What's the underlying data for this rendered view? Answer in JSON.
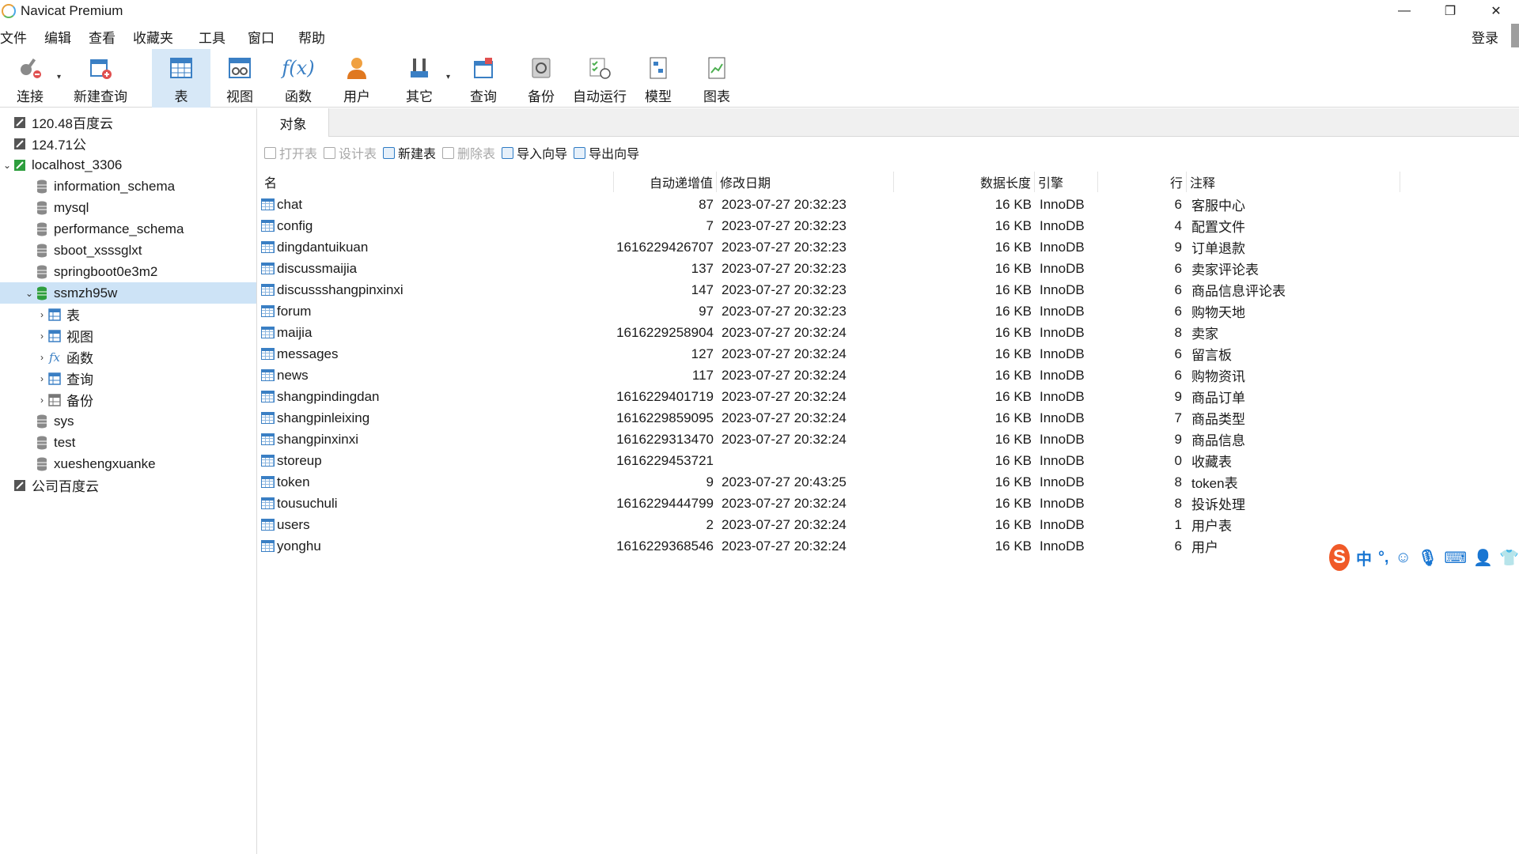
{
  "window": {
    "title": "Navicat Premium",
    "controls": [
      "—",
      "❐",
      "✕"
    ]
  },
  "menu": {
    "items": [
      "文件",
      "编辑",
      "查看",
      "收藏夹",
      "工具",
      "窗口",
      "帮助"
    ],
    "login": "登录"
  },
  "toolbar": {
    "items": [
      {
        "label": "连接",
        "icon": "connection-icon"
      },
      {
        "label": "新建查询",
        "icon": "new-query-icon"
      },
      {
        "label": "表",
        "icon": "table-icon",
        "active": true
      },
      {
        "label": "视图",
        "icon": "view-icon"
      },
      {
        "label": "函数",
        "icon": "function-icon",
        "glyph": "f(x)"
      },
      {
        "label": "用户",
        "icon": "user-icon"
      },
      {
        "label": "其它",
        "icon": "tools-icon"
      },
      {
        "label": "查询",
        "icon": "query-icon"
      },
      {
        "label": "备份",
        "icon": "backup-icon"
      },
      {
        "label": "自动运行",
        "icon": "schedule-icon"
      },
      {
        "label": "模型",
        "icon": "model-icon"
      },
      {
        "label": "图表",
        "icon": "chart-icon"
      }
    ]
  },
  "sidebar": {
    "items": [
      {
        "label": "120.48百度云",
        "level": 0,
        "icon": "connection-icon",
        "arrow": ""
      },
      {
        "label": "124.71公",
        "level": 0,
        "icon": "connection-icon",
        "arrow": ""
      },
      {
        "label": "localhost_3306",
        "level": 0,
        "icon": "connection-active-icon",
        "arrow": "⌄"
      },
      {
        "label": "information_schema",
        "level": 1,
        "icon": "database-icon",
        "arrow": ""
      },
      {
        "label": "mysql",
        "level": 1,
        "icon": "database-icon",
        "arrow": ""
      },
      {
        "label": "performance_schema",
        "level": 1,
        "icon": "database-icon",
        "arrow": ""
      },
      {
        "label": "sboot_xsssglxt",
        "level": 1,
        "icon": "database-icon",
        "arrow": ""
      },
      {
        "label": "springboot0e3m2",
        "level": 1,
        "icon": "database-icon",
        "arrow": ""
      },
      {
        "label": "ssmzh95w",
        "level": 1,
        "icon": "database-open-icon",
        "arrow": "⌄",
        "selected": true
      },
      {
        "label": "表",
        "level": 2,
        "icon": "table-icon",
        "arrow": "›"
      },
      {
        "label": "视图",
        "level": 2,
        "icon": "view-icon",
        "arrow": "›"
      },
      {
        "label": "函数",
        "level": 2,
        "icon": "function-icon",
        "arrow": "›"
      },
      {
        "label": "查询",
        "level": 2,
        "icon": "query-icon",
        "arrow": "›"
      },
      {
        "label": "备份",
        "level": 2,
        "icon": "backup-icon",
        "arrow": "›"
      },
      {
        "label": "sys",
        "level": 1,
        "icon": "database-icon",
        "arrow": ""
      },
      {
        "label": "test",
        "level": 1,
        "icon": "database-icon",
        "arrow": ""
      },
      {
        "label": "xueshengxuanke",
        "level": 1,
        "icon": "database-icon",
        "arrow": ""
      },
      {
        "label": "公司百度云",
        "level": 0,
        "icon": "connection-icon",
        "arrow": ""
      }
    ]
  },
  "tabs": {
    "objects": "对象"
  },
  "object_toolbar": {
    "items": [
      {
        "label": "打开表",
        "enabled": false
      },
      {
        "label": "设计表",
        "enabled": false
      },
      {
        "label": "新建表",
        "enabled": true
      },
      {
        "label": "删除表",
        "enabled": false
      },
      {
        "label": "导入向导",
        "enabled": true
      },
      {
        "label": "导出向导",
        "enabled": true
      }
    ]
  },
  "table": {
    "columns": [
      "名",
      "自动递增值",
      "修改日期",
      "数据长度",
      "引擎",
      "行",
      "注释"
    ],
    "rows": [
      {
        "name": "chat",
        "auto_inc": "87",
        "modified": "2023-07-27 20:32:23",
        "size": "16 KB",
        "engine": "InnoDB",
        "rows": "6",
        "comment": "客服中心"
      },
      {
        "name": "config",
        "auto_inc": "7",
        "modified": "2023-07-27 20:32:23",
        "size": "16 KB",
        "engine": "InnoDB",
        "rows": "4",
        "comment": "配置文件"
      },
      {
        "name": "dingdantuikuan",
        "auto_inc": "1616229426707",
        "modified": "2023-07-27 20:32:23",
        "size": "16 KB",
        "engine": "InnoDB",
        "rows": "9",
        "comment": "订单退款"
      },
      {
        "name": "discussmaijia",
        "auto_inc": "137",
        "modified": "2023-07-27 20:32:23",
        "size": "16 KB",
        "engine": "InnoDB",
        "rows": "6",
        "comment": "卖家评论表"
      },
      {
        "name": "discussshangpinxinxi",
        "auto_inc": "147",
        "modified": "2023-07-27 20:32:23",
        "size": "16 KB",
        "engine": "InnoDB",
        "rows": "6",
        "comment": "商品信息评论表"
      },
      {
        "name": "forum",
        "auto_inc": "97",
        "modified": "2023-07-27 20:32:23",
        "size": "16 KB",
        "engine": "InnoDB",
        "rows": "6",
        "comment": "购物天地"
      },
      {
        "name": "maijia",
        "auto_inc": "1616229258904",
        "modified": "2023-07-27 20:32:24",
        "size": "16 KB",
        "engine": "InnoDB",
        "rows": "8",
        "comment": "卖家"
      },
      {
        "name": "messages",
        "auto_inc": "127",
        "modified": "2023-07-27 20:32:24",
        "size": "16 KB",
        "engine": "InnoDB",
        "rows": "6",
        "comment": "留言板"
      },
      {
        "name": "news",
        "auto_inc": "117",
        "modified": "2023-07-27 20:32:24",
        "size": "16 KB",
        "engine": "InnoDB",
        "rows": "6",
        "comment": "购物资讯"
      },
      {
        "name": "shangpindingdan",
        "auto_inc": "1616229401719",
        "modified": "2023-07-27 20:32:24",
        "size": "16 KB",
        "engine": "InnoDB",
        "rows": "9",
        "comment": "商品订单"
      },
      {
        "name": "shangpinleixing",
        "auto_inc": "1616229859095",
        "modified": "2023-07-27 20:32:24",
        "size": "16 KB",
        "engine": "InnoDB",
        "rows": "7",
        "comment": "商品类型"
      },
      {
        "name": "shangpinxinxi",
        "auto_inc": "1616229313470",
        "modified": "2023-07-27 20:32:24",
        "size": "16 KB",
        "engine": "InnoDB",
        "rows": "9",
        "comment": "商品信息"
      },
      {
        "name": "storeup",
        "auto_inc": "1616229453721",
        "modified": "",
        "size": "16 KB",
        "engine": "InnoDB",
        "rows": "0",
        "comment": "收藏表"
      },
      {
        "name": "token",
        "auto_inc": "9",
        "modified": "2023-07-27 20:43:25",
        "size": "16 KB",
        "engine": "InnoDB",
        "rows": "8",
        "comment": "token表"
      },
      {
        "name": "tousuchuli",
        "auto_inc": "1616229444799",
        "modified": "2023-07-27 20:32:24",
        "size": "16 KB",
        "engine": "InnoDB",
        "rows": "8",
        "comment": "投诉处理"
      },
      {
        "name": "users",
        "auto_inc": "2",
        "modified": "2023-07-27 20:32:24",
        "size": "16 KB",
        "engine": "InnoDB",
        "rows": "1",
        "comment": "用户表"
      },
      {
        "name": "yonghu",
        "auto_inc": "1616229368546",
        "modified": "2023-07-27 20:32:24",
        "size": "16 KB",
        "engine": "InnoDB",
        "rows": "6",
        "comment": "用户"
      }
    ]
  },
  "ime": {
    "logo": "S",
    "mode": "中",
    "punct": "°,",
    "icons": [
      "emoji-icon",
      "mic-icon",
      "keyboard-icon",
      "user-icon",
      "shirt-icon"
    ]
  },
  "colors": {
    "accent": "#2e7bc4",
    "selection": "#cde3f6",
    "toolbar_active": "#d7e8f7",
    "ime_brand": "#f05a28"
  }
}
